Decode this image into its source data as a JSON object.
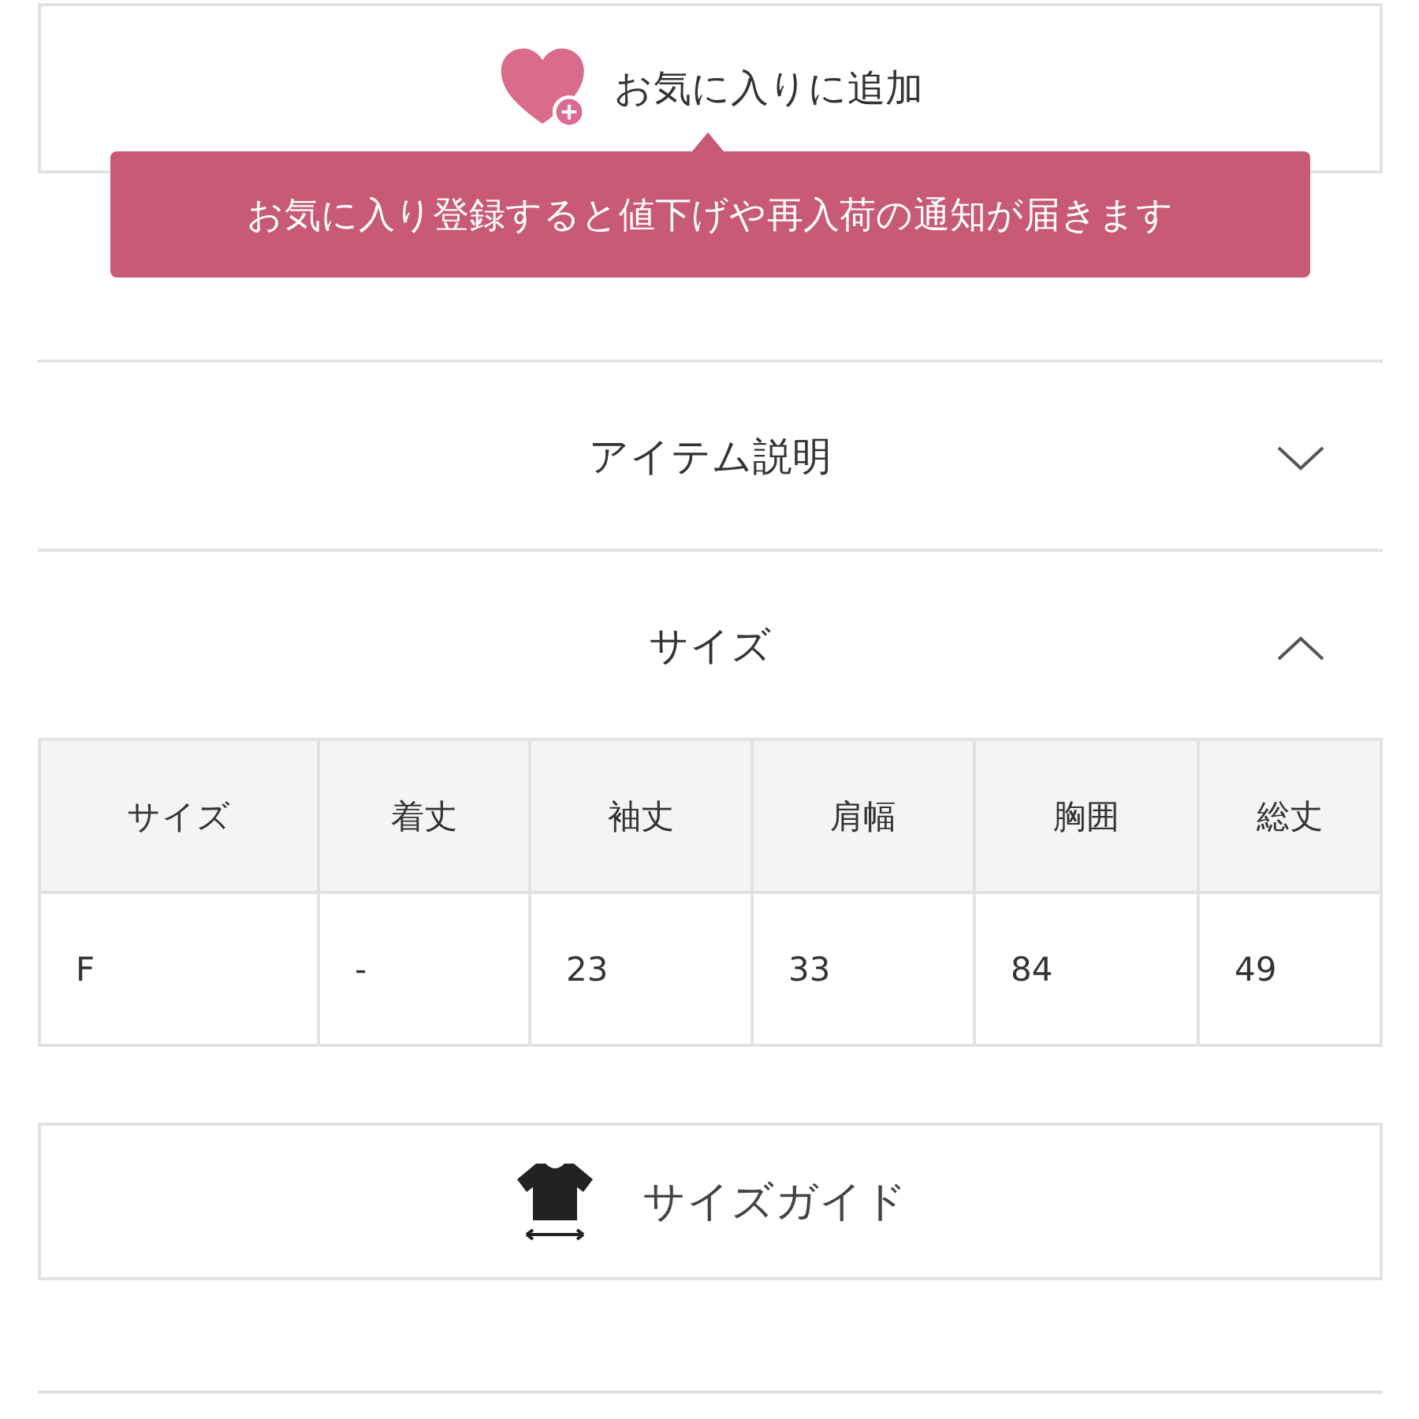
{
  "favorite_button": {
    "label": "お気に入りに追加"
  },
  "tooltip": {
    "text": "お気に入り登録すると値下げや再入荷の通知が届きます"
  },
  "sections": [
    {
      "title": "アイテム説明",
      "expanded": false
    },
    {
      "title": "サイズ",
      "expanded": true,
      "table": {
        "columns": [
          "サイズ",
          "着丈",
          "袖丈",
          "肩幅",
          "胸囲",
          "総丈"
        ],
        "rows": [
          [
            "F",
            "-",
            "23",
            "33",
            "84",
            "49"
          ]
        ]
      }
    }
  ],
  "size_guide_button": {
    "label": "サイズガイド"
  }
}
